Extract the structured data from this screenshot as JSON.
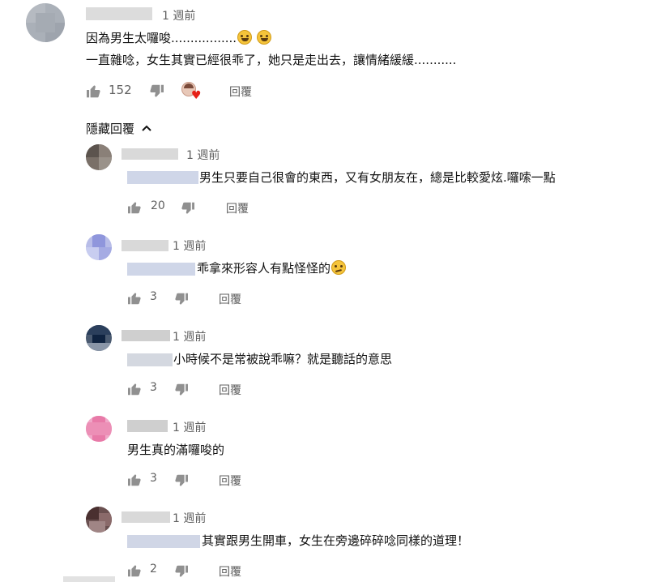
{
  "top_comment": {
    "time": "1 週前",
    "line1": "因為男生太囉唆.................",
    "line2": "一直雜唸，女生其實已經很乖了，她只是走出去，讓情緒緩緩...........",
    "likes": "152",
    "reply_label": "回覆"
  },
  "hide_replies_label": "隱藏回覆",
  "replies": [
    {
      "time": "1 週前",
      "text": "男生只要自己很會的東西，又有女朋友在，總是比較愛炫.囉嗦一點",
      "likes": "20",
      "reply_label": "回覆"
    },
    {
      "time": "1 週前",
      "text": "乖拿來形容人有點怪怪的",
      "likes": "3",
      "reply_label": "回覆"
    },
    {
      "time": "1 週前",
      "text": "小時候不是常被說乖嘛？就是聽話的意思",
      "likes": "3",
      "reply_label": "回覆"
    },
    {
      "time": "1 週前",
      "text": "男生真的滿囉唆的",
      "likes": "3",
      "reply_label": "回覆"
    },
    {
      "time": "1 週前",
      "text": "其實跟男生開車，女生在旁邊碎碎唸同樣的道理！",
      "likes": "2",
      "reply_label": "回覆"
    }
  ]
}
